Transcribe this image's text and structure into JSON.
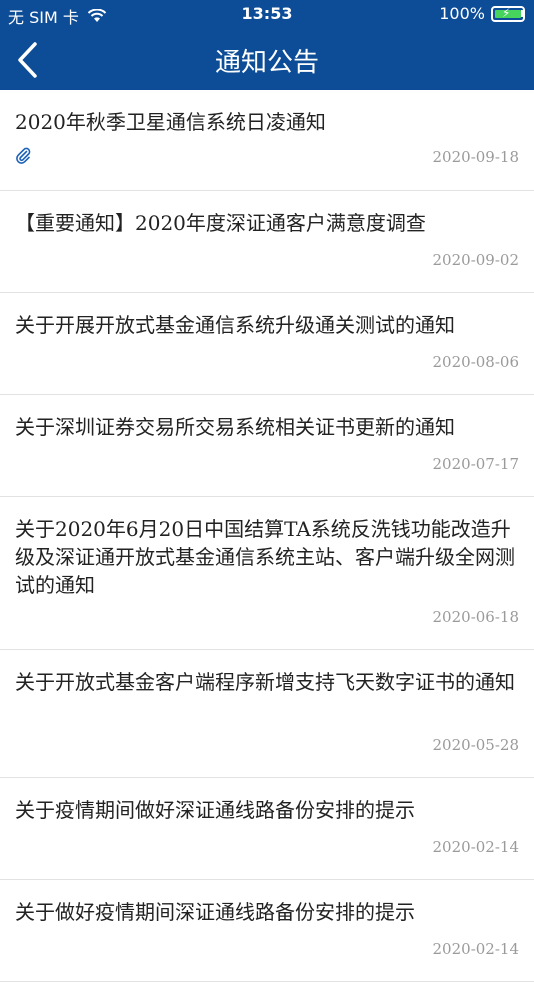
{
  "status_bar": {
    "carrier": "无 SIM 卡",
    "time": "13:53",
    "battery": "100%",
    "battery_level": 1.0
  },
  "nav": {
    "title": "通知公告",
    "back_icon": "chevron-left-icon"
  },
  "colors": {
    "header_bg": "#0d4c96",
    "battery_fill": "#47d45c",
    "attachment": "#1d62b8"
  },
  "notices": [
    {
      "title": "2020年秋季卫星通信系统日凌通知",
      "date": "2020-09-18",
      "attachment": true
    },
    {
      "title": "【重要通知】2020年度深证通客户满意度调查",
      "date": "2020-09-02",
      "attachment": false
    },
    {
      "title": "关于开展开放式基金通信系统升级通关测试的通知",
      "date": "2020-08-06",
      "attachment": false
    },
    {
      "title": "关于深圳证券交易所交易系统相关证书更新的通知",
      "date": "2020-07-17",
      "attachment": false
    },
    {
      "title": "关于2020年6月20日中国结算TA系统反洗钱功能改造升级及深证通开放式基金通信系统主站、客户端升级全网测试的通知",
      "date": "2020-06-18",
      "attachment": false
    },
    {
      "title": "关于开放式基金客户端程序新增支持飞天数字证书的通知",
      "date": "2020-05-28",
      "attachment": false
    },
    {
      "title": "关于疫情期间做好深证通线路备份安排的提示",
      "date": "2020-02-14",
      "attachment": false
    },
    {
      "title": "关于做好疫情期间深证通线路备份安排的提示",
      "date": "2020-02-14",
      "attachment": false
    }
  ]
}
